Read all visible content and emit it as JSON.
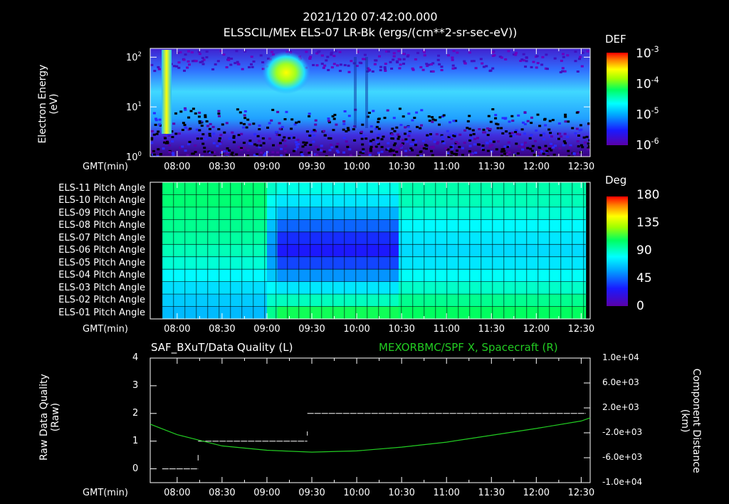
{
  "header": {
    "line1": "2021/120 07:42:00.000",
    "line2": "ELSSCIL/MEx ELS-07 LR-Bk  (ergs/(cm**2-sr-sec-eV))"
  },
  "time_ticks": [
    "08:00",
    "08:30",
    "09:00",
    "09:30",
    "10:00",
    "10:30",
    "11:00",
    "11:30",
    "12:00",
    "12:30"
  ],
  "gmt_label": "GMT(min)",
  "colors": {
    "background": "#000000",
    "foreground": "#ffffff",
    "spacecraft_line": "#22cc22"
  },
  "panel1": {
    "ylabel_line1": "Electron Energy",
    "ylabel_line2": "(eV)",
    "y_ticks": [
      {
        "base": "10",
        "exp": "0"
      },
      {
        "base": "10",
        "exp": "1"
      },
      {
        "base": "10",
        "exp": "2"
      }
    ],
    "colorbar": {
      "title": "DEF",
      "ticks": [
        {
          "base": "10",
          "exp": "-3"
        },
        {
          "base": "10",
          "exp": "-4"
        },
        {
          "base": "10",
          "exp": "-5"
        },
        {
          "base": "10",
          "exp": "-6"
        }
      ]
    }
  },
  "panel2": {
    "rows": [
      "ELS-11 Pitch Angle",
      "ELS-10 Pitch Angle",
      "ELS-09 Pitch Angle",
      "ELS-08 Pitch Angle",
      "ELS-07 Pitch Angle",
      "ELS-06 Pitch Angle",
      "ELS-05 Pitch Angle",
      "ELS-04 Pitch Angle",
      "ELS-03 Pitch Angle",
      "ELS-02 Pitch Angle",
      "ELS-01 Pitch Angle"
    ],
    "colorbar": {
      "title": "Deg",
      "ticks": [
        "180",
        "135",
        "90",
        "45",
        "0"
      ]
    }
  },
  "panel3": {
    "title_left": "SAF_BXuT/Data Quality (L)",
    "title_right": "MEXORBMC/SPF X, Spacecraft (R)",
    "ylabel_left_line1": "Raw Data Quality",
    "ylabel_left_line2": "(Raw)",
    "ylabel_right_line1": "Component Distance",
    "ylabel_right_line2": "(km)",
    "left_ticks": [
      "4",
      "3",
      "2",
      "1",
      "0"
    ],
    "right_ticks": [
      "1.0e+04",
      "6.0e+03",
      "2.0e+03",
      "-2.0e+03",
      "-6.0e+03",
      "-1.0e+04"
    ]
  },
  "chart_data": [
    {
      "type": "heatmap",
      "title": "ELSSCIL/MEx ELS-07 LR-Bk  (ergs/(cm**2-sr-sec-eV))",
      "xlabel": "GMT(min)",
      "ylabel": "Electron Energy (eV)",
      "x_range": [
        "07:42",
        "12:36"
      ],
      "ylim": [
        1,
        150
      ],
      "y_scale": "log",
      "colorbar_label": "DEF",
      "colorbar_range": [
        1e-06,
        0.001
      ],
      "features": [
        {
          "time": "07:52",
          "energy_range": [
            1,
            150
          ],
          "level": "1e-3"
        },
        {
          "time_range": [
            "09:00",
            "09:25"
          ],
          "energy_range": [
            30,
            150
          ],
          "level": "1e-3"
        },
        {
          "time_range": [
            "07:42",
            "12:36"
          ],
          "energy_range": [
            3,
            30
          ],
          "level": "1e-5"
        },
        {
          "time_range": [
            "07:42",
            "12:36"
          ],
          "energy_range": [
            1,
            3
          ],
          "level": "1e-6"
        }
      ]
    },
    {
      "type": "heatmap",
      "xlabel": "GMT(min)",
      "categories": [
        "ELS-11",
        "ELS-10",
        "ELS-09",
        "ELS-08",
        "ELS-07",
        "ELS-06",
        "ELS-05",
        "ELS-04",
        "ELS-03",
        "ELS-02",
        "ELS-01"
      ],
      "colorbar_label": "Deg",
      "colorbar_range": [
        0,
        180
      ],
      "segments": [
        {
          "time_range": [
            "07:50",
            "09:00"
          ],
          "values": [
            105,
            105,
            102,
            100,
            97,
            93,
            88,
            80,
            73,
            68,
            64
          ]
        },
        {
          "time_range": [
            "09:00",
            "09:07"
          ],
          "values": [
            90,
            83,
            75,
            65,
            58,
            54,
            58,
            67,
            80,
            90,
            100
          ]
        },
        {
          "time_range": [
            "09:07",
            "10:28"
          ],
          "values": [
            85,
            75,
            62,
            45,
            33,
            28,
            38,
            55,
            75,
            92,
            110
          ]
        },
        {
          "time_range": [
            "10:28",
            "12:33"
          ],
          "values": [
            95,
            93,
            88,
            80,
            75,
            72,
            75,
            82,
            90,
            100,
            108
          ]
        }
      ]
    },
    {
      "type": "line",
      "xlabel": "GMT(min)",
      "series": [
        {
          "axis": "left",
          "x": [
            "07:50",
            "08:14"
          ],
          "y": [
            0,
            0
          ]
        },
        {
          "axis": "left",
          "x": [
            "08:14",
            "09:27"
          ],
          "y": [
            1,
            1
          ]
        },
        {
          "axis": "left",
          "x": [
            "09:27",
            "12:33"
          ],
          "y": [
            2,
            2
          ]
        },
        {
          "axis": "right",
          "x": [
            "07:42",
            "08:00",
            "08:30",
            "09:00",
            "09:30",
            "10:00",
            "10:30",
            "11:00",
            "11:30",
            "12:00",
            "12:30",
            "12:36"
          ],
          "y": [
            -600,
            -2300,
            -4100,
            -4800,
            -5100,
            -4900,
            -4300,
            -3500,
            -2400,
            -1300,
            -100,
            400
          ]
        }
      ],
      "ylim_left": [
        -0.5,
        4
      ],
      "ylim_right": [
        -10000,
        10000
      ]
    }
  ]
}
